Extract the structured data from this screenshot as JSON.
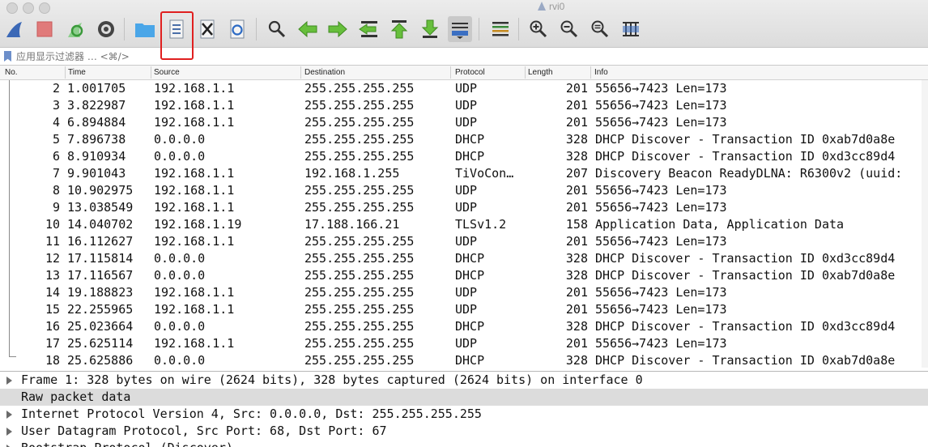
{
  "window": {
    "title": "rvi0"
  },
  "filter": {
    "placeholder": "应用显示过滤器 … <⌘/>"
  },
  "columns": [
    "No.",
    "Time",
    "Source",
    "Destination",
    "Protocol",
    "Length",
    "Info"
  ],
  "packets": [
    {
      "no": "2",
      "time": "1.001705",
      "src": "192.168.1.1",
      "dst": "255.255.255.255",
      "proto": "UDP",
      "len": "201",
      "info": "55656→7423 Len=173"
    },
    {
      "no": "3",
      "time": "3.822987",
      "src": "192.168.1.1",
      "dst": "255.255.255.255",
      "proto": "UDP",
      "len": "201",
      "info": "55656→7423 Len=173"
    },
    {
      "no": "4",
      "time": "6.894884",
      "src": "192.168.1.1",
      "dst": "255.255.255.255",
      "proto": "UDP",
      "len": "201",
      "info": "55656→7423 Len=173"
    },
    {
      "no": "5",
      "time": "7.896738",
      "src": "0.0.0.0",
      "dst": "255.255.255.255",
      "proto": "DHCP",
      "len": "328",
      "info": "DHCP Discover - Transaction ID 0xab7d0a8e"
    },
    {
      "no": "6",
      "time": "8.910934",
      "src": "0.0.0.0",
      "dst": "255.255.255.255",
      "proto": "DHCP",
      "len": "328",
      "info": "DHCP Discover - Transaction ID 0xd3cc89d4"
    },
    {
      "no": "7",
      "time": "9.901043",
      "src": "192.168.1.1",
      "dst": "192.168.1.255",
      "proto": "TiVoCon…",
      "len": "207",
      "info": "Discovery Beacon ReadyDLNA: R6300v2 (uuid:"
    },
    {
      "no": "8",
      "time": "10.902975",
      "src": "192.168.1.1",
      "dst": "255.255.255.255",
      "proto": "UDP",
      "len": "201",
      "info": "55656→7423 Len=173"
    },
    {
      "no": "9",
      "time": "13.038549",
      "src": "192.168.1.1",
      "dst": "255.255.255.255",
      "proto": "UDP",
      "len": "201",
      "info": "55656→7423 Len=173"
    },
    {
      "no": "10",
      "time": "14.040702",
      "src": "192.168.1.19",
      "dst": "17.188.166.21",
      "proto": "TLSv1.2",
      "len": "158",
      "info": "Application Data, Application Data"
    },
    {
      "no": "11",
      "time": "16.112627",
      "src": "192.168.1.1",
      "dst": "255.255.255.255",
      "proto": "UDP",
      "len": "201",
      "info": "55656→7423 Len=173"
    },
    {
      "no": "12",
      "time": "17.115814",
      "src": "0.0.0.0",
      "dst": "255.255.255.255",
      "proto": "DHCP",
      "len": "328",
      "info": "DHCP Discover - Transaction ID 0xd3cc89d4"
    },
    {
      "no": "13",
      "time": "17.116567",
      "src": "0.0.0.0",
      "dst": "255.255.255.255",
      "proto": "DHCP",
      "len": "328",
      "info": "DHCP Discover - Transaction ID 0xab7d0a8e"
    },
    {
      "no": "14",
      "time": "19.188823",
      "src": "192.168.1.1",
      "dst": "255.255.255.255",
      "proto": "UDP",
      "len": "201",
      "info": "55656→7423 Len=173"
    },
    {
      "no": "15",
      "time": "22.255965",
      "src": "192.168.1.1",
      "dst": "255.255.255.255",
      "proto": "UDP",
      "len": "201",
      "info": "55656→7423 Len=173"
    },
    {
      "no": "16",
      "time": "25.023664",
      "src": "0.0.0.0",
      "dst": "255.255.255.255",
      "proto": "DHCP",
      "len": "328",
      "info": "DHCP Discover - Transaction ID 0xd3cc89d4"
    },
    {
      "no": "17",
      "time": "25.625114",
      "src": "192.168.1.1",
      "dst": "255.255.255.255",
      "proto": "UDP",
      "len": "201",
      "info": "55656→7423 Len=173"
    },
    {
      "no": "18",
      "time": "25.625886",
      "src": "0.0.0.0",
      "dst": "255.255.255.255",
      "proto": "DHCP",
      "len": "328",
      "info": "DHCP Discover - Transaction ID 0xab7d0a8e"
    }
  ],
  "details": [
    {
      "text": "Frame 1: 328 bytes on wire (2624 bits), 328 bytes captured (2624 bits) on interface 0",
      "expandable": true,
      "selected": false
    },
    {
      "text": "Raw packet data",
      "expandable": false,
      "selected": true
    },
    {
      "text": "Internet Protocol Version 4, Src: 0.0.0.0, Dst: 255.255.255.255",
      "expandable": true,
      "selected": false
    },
    {
      "text": "User Datagram Protocol, Src Port: 68, Dst Port: 67",
      "expandable": true,
      "selected": false
    },
    {
      "text": "Bootstrap Protocol (Discover)",
      "expandable": true,
      "selected": false
    }
  ],
  "toolbar": [
    {
      "name": "start-capture-icon"
    },
    {
      "name": "stop-capture-icon"
    },
    {
      "name": "restart-capture-icon"
    },
    {
      "name": "capture-options-icon"
    },
    {
      "name": "open-file-icon"
    },
    {
      "name": "save-file-icon"
    },
    {
      "name": "close-file-icon"
    },
    {
      "name": "reload-file-icon"
    },
    {
      "name": "find-packet-icon"
    },
    {
      "name": "go-back-icon"
    },
    {
      "name": "go-forward-icon"
    },
    {
      "name": "go-to-packet-icon"
    },
    {
      "name": "go-first-packet-icon"
    },
    {
      "name": "go-last-packet-icon"
    },
    {
      "name": "auto-scroll-icon"
    },
    {
      "name": "colorize-icon"
    },
    {
      "name": "zoom-in-icon"
    },
    {
      "name": "zoom-out-icon"
    },
    {
      "name": "normal-size-icon"
    },
    {
      "name": "resize-columns-icon"
    }
  ]
}
